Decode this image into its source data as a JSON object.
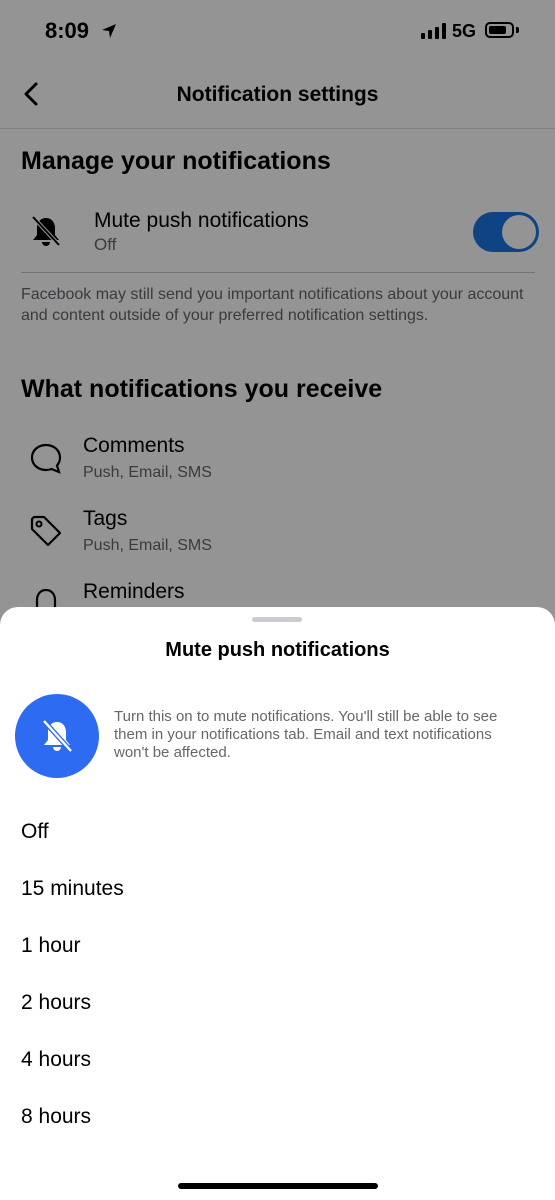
{
  "status_bar": {
    "time": "8:09",
    "network": "5G"
  },
  "header": {
    "title": "Notification settings",
    "back_icon": "chevron-left-icon"
  },
  "manage": {
    "title": "Manage your notifications",
    "mute_label": "Mute push notifications",
    "mute_value": "Off",
    "disclaimer": "Facebook may still send you important notifications about your account and content outside of your preferred notification settings."
  },
  "receive": {
    "title": "What notifications you receive",
    "items": [
      {
        "label": "Comments",
        "channels": "Push, Email, SMS",
        "icon": "comment-bubble-icon"
      },
      {
        "label": "Tags",
        "channels": "Push, Email, SMS",
        "icon": "tag-icon"
      },
      {
        "label": "Reminders",
        "icon": "bell-icon"
      }
    ]
  },
  "sheet": {
    "title": "Mute push notifications",
    "description": "Turn this on to mute notifications. You'll still be able to see them in your notifications tab. Email and text notifications won't be affected.",
    "icon": "muted-bell-icon",
    "options": [
      "Off",
      "15 minutes",
      "1 hour",
      "2 hours",
      "4 hours",
      "8 hours"
    ]
  },
  "colors": {
    "accent": "#1b74e4",
    "sheet_icon_bg": "#2d6bf0",
    "secondary_text": "#65676b"
  }
}
